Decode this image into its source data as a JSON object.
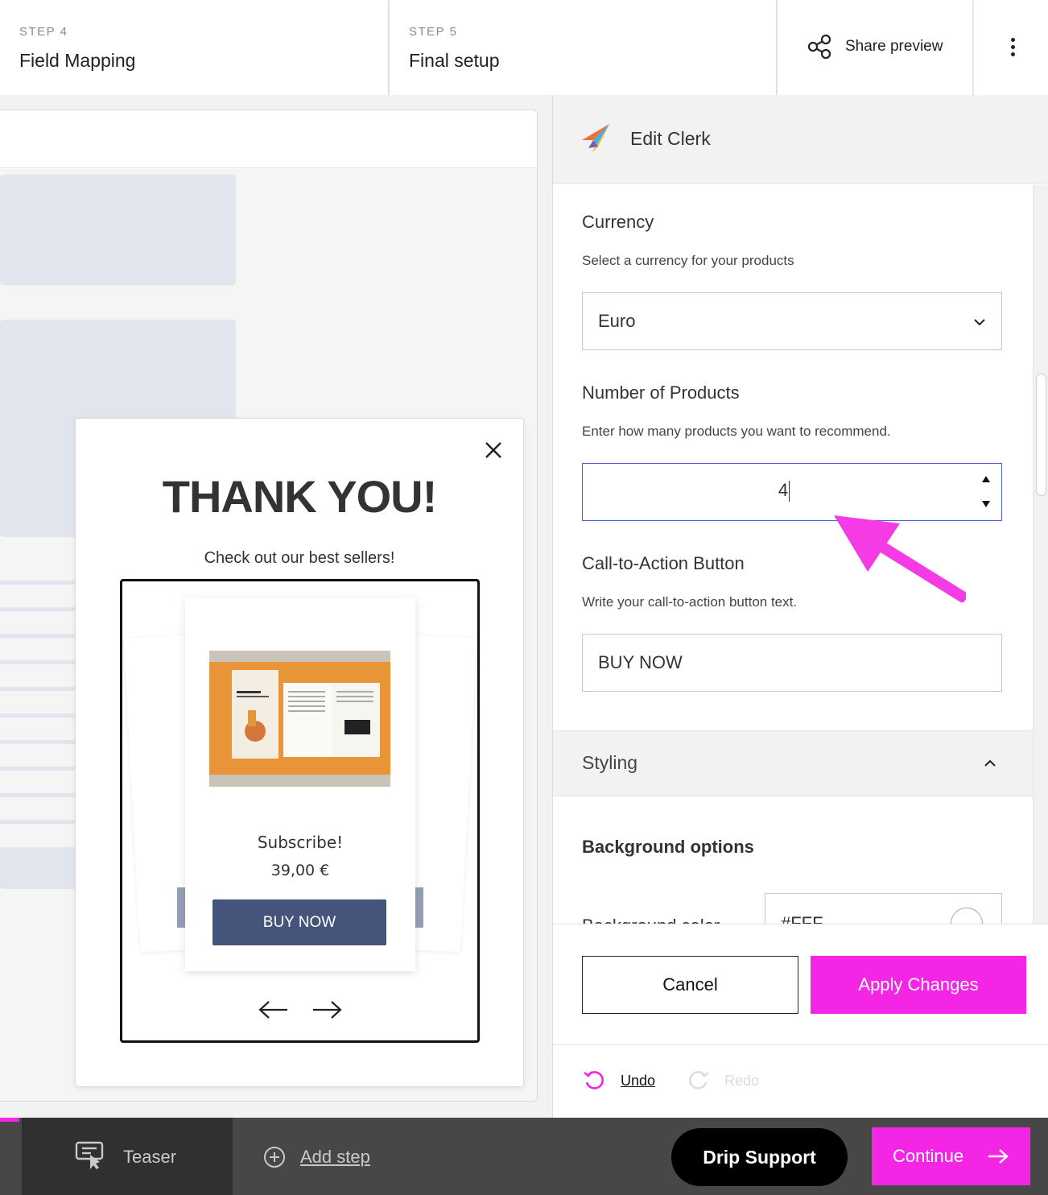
{
  "topbar": {
    "steps": [
      {
        "kicker": "STEP 4",
        "title": "Field Mapping"
      },
      {
        "kicker": "STEP 5",
        "title": "Final setup"
      }
    ],
    "share_label": "Share preview",
    "icons": {
      "share": "share-icon",
      "more": "more-vertical-icon"
    }
  },
  "popup": {
    "headline": "THANK YOU!",
    "subtitle": "Check out our best sellers!",
    "product": {
      "name": "Subscribe!",
      "price": "39,00 €",
      "button": "BUY NOW"
    },
    "icons": {
      "close": "close-icon",
      "prev": "arrow-left-icon",
      "next": "arrow-right-icon"
    }
  },
  "panel": {
    "title": "Edit Clerk",
    "currency": {
      "label": "Currency",
      "hint": "Select a currency for your products",
      "value": "Euro"
    },
    "products": {
      "label": "Number of Products",
      "hint": "Enter how many products you want to recommend.",
      "value": "4"
    },
    "cta": {
      "label": "Call-to-Action Button",
      "hint": "Write your call-to-action button text.",
      "value": "BUY NOW"
    },
    "styling": {
      "label": "Styling",
      "background_title": "Background options",
      "bg_color_label": "Background color",
      "bg_color_value": "#FFF"
    },
    "cancel_label": "Cancel",
    "apply_label": "Apply Changes",
    "undo_label": "Undo",
    "redo_label": "Redo"
  },
  "bottombar": {
    "teaser_label": "Teaser",
    "add_step_label": "Add step",
    "support_label": "Drip Support",
    "continue_label": "Continue"
  },
  "colors": {
    "accent": "#f425e4",
    "product_button": "#44547a",
    "focus_border": "#4f5fd6"
  }
}
